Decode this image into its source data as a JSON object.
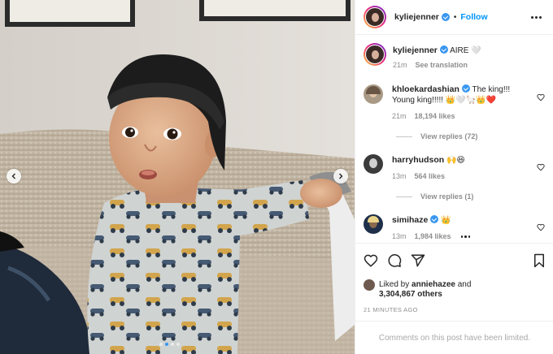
{
  "header": {
    "username": "kyliejenner",
    "follow_label": "Follow",
    "separator": "•"
  },
  "caption": {
    "username": "kyliejenner",
    "text": "AIRE 🤍",
    "time": "21m",
    "translation_label": "See translation"
  },
  "comments": [
    {
      "username": "khloekardashian",
      "verified": true,
      "text": "The king!!! Young king!!!!! 👑🤍🦙👑❤️",
      "time": "21m",
      "likes": "18,194 likes",
      "replies_label": "View replies (72)"
    },
    {
      "username": "harryhudson",
      "verified": false,
      "text": "🙌😆",
      "time": "13m",
      "likes": "564 likes",
      "replies_label": "View replies (1)"
    },
    {
      "username": "simihaze",
      "verified": true,
      "text": "👑",
      "time": "13m",
      "likes": "1,984 likes"
    }
  ],
  "likes_summary": {
    "prefix": "Liked by ",
    "user": "anniehazee",
    "middle": " and",
    "count": "3,304,867 others"
  },
  "posted_ago": "21 MINUTES AGO",
  "comments_limited": "Comments on this post have been limited.",
  "carousel": {
    "total": 4,
    "active_index": 1
  },
  "icons": [
    "heart-icon",
    "comment-icon",
    "share-icon",
    "save-icon",
    "more-icon",
    "chevron-left-icon",
    "chevron-right-icon",
    "verified-badge-icon"
  ],
  "colors": {
    "accent": "#0095f6",
    "verified": "#3897f0",
    "muted": "#8e8e8e",
    "text": "#262626"
  }
}
